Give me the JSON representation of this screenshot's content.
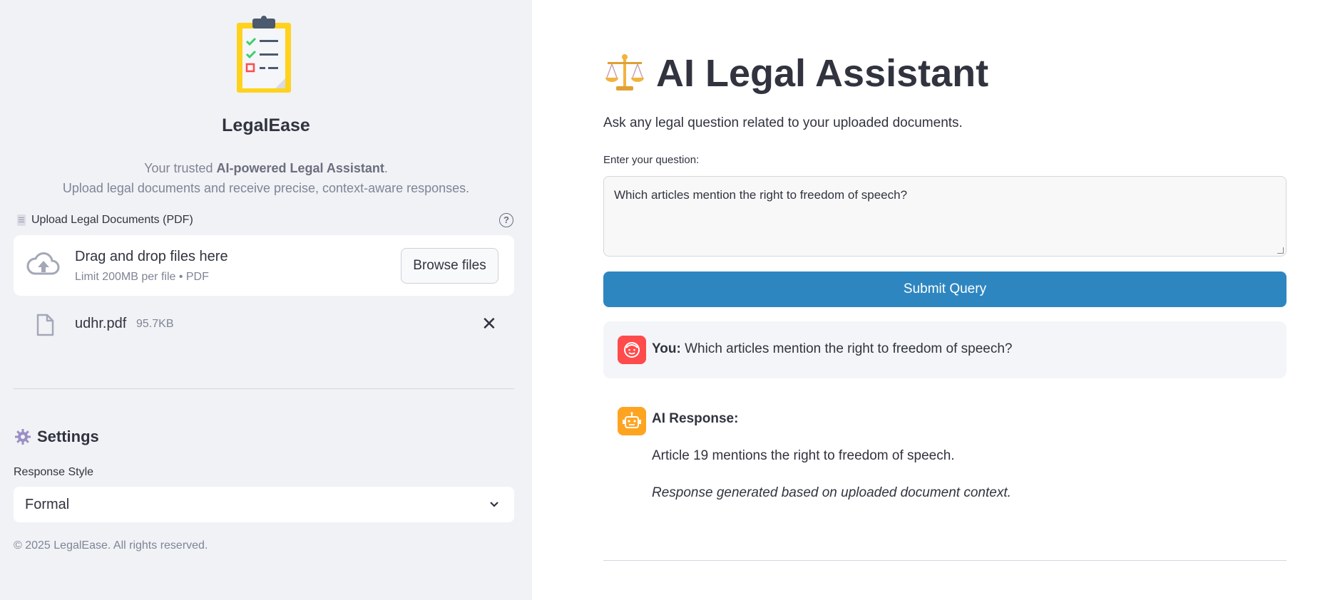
{
  "sidebar": {
    "brand": "LegalEase",
    "tagline_prefix": "Your trusted ",
    "tagline_bold": "AI-powered Legal Assistant",
    "tagline_suffix": ".",
    "tagline_line2": "Upload legal documents and receive precise, context-aware responses.",
    "upload_label": "Upload Legal Documents (PDF)",
    "help_glyph": "?",
    "dropzone": {
      "title": "Drag and drop files here",
      "subtitle": "Limit 200MB per file • PDF",
      "browse_label": "Browse files"
    },
    "file": {
      "name": "udhr.pdf",
      "size": "95.7KB",
      "remove_glyph": "✕"
    },
    "settings": {
      "title": "Settings",
      "response_style_label": "Response Style",
      "response_style_value": "Formal"
    },
    "copyright": "© 2025 LegalEase. All rights reserved."
  },
  "main": {
    "title": "AI Legal Assistant",
    "subtitle": "Ask any legal question related to your uploaded documents.",
    "question_label": "Enter your question:",
    "question_value": "Which articles mention the right to freedom of speech?",
    "submit_label": "Submit Query",
    "user_message": {
      "speaker": "You:",
      "text": "Which articles mention the right to freedom of speech?"
    },
    "ai_message": {
      "heading": "AI Response:",
      "body": "Article 19 mentions the right to freedom of speech.",
      "note": "Response generated based on uploaded document context."
    }
  },
  "colors": {
    "accent": "#2e86c1",
    "sidebar_bg": "#f0f2f6",
    "user_avatar": "#ff4b4b",
    "ai_avatar": "#ffa421"
  },
  "icons": [
    "clipboard-checklist-icon",
    "document-icon",
    "help-icon",
    "cloud-upload-icon",
    "file-icon",
    "close-icon",
    "gear-icon",
    "chevron-down-icon",
    "scales-icon",
    "user-face-icon",
    "robot-icon"
  ]
}
